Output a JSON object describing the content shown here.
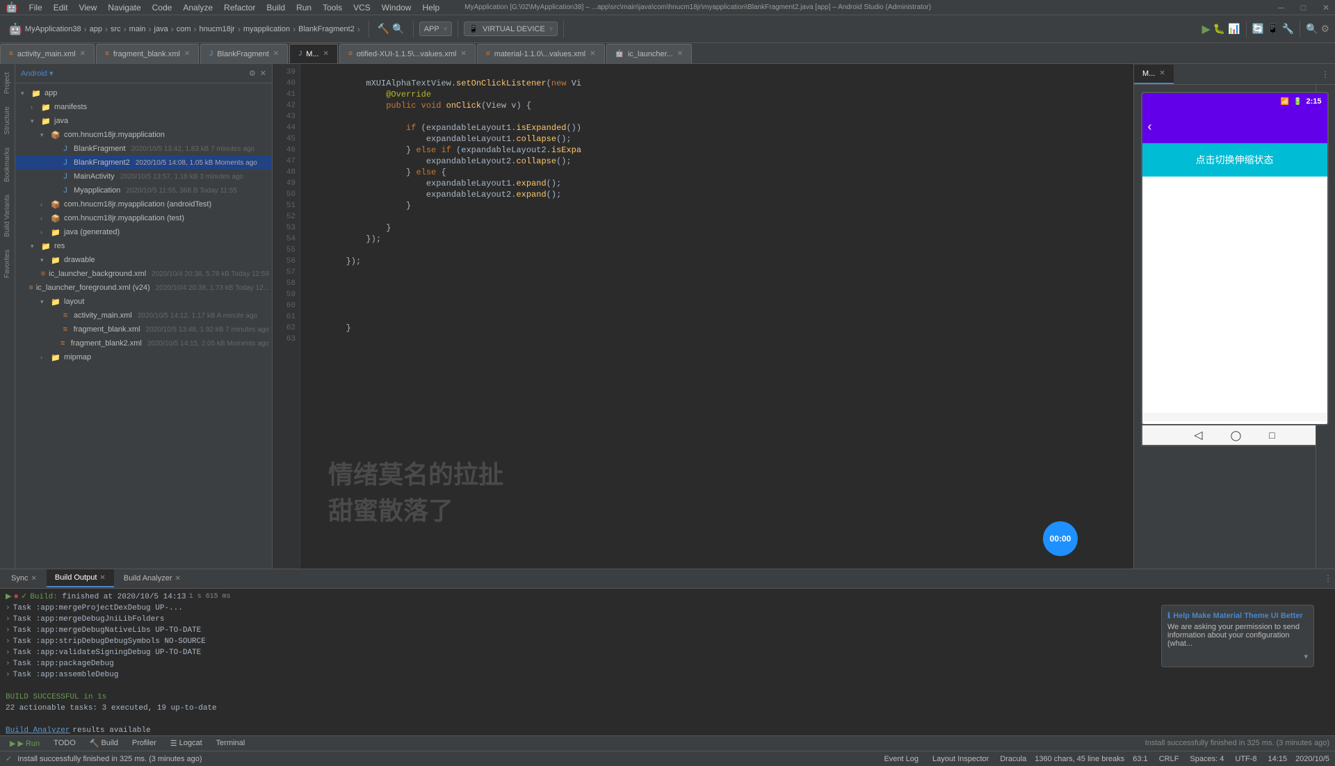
{
  "app": {
    "title": "MyApplication [G:\\02\\MyApplication38] – ...app\\src\\main\\java\\com\\hnucm18jr\\myapplication\\BlankFragment2.java [app] – Android Studio (Administrator)"
  },
  "menu": {
    "items": [
      "File",
      "Edit",
      "View",
      "Navigate",
      "Code",
      "Analyze",
      "Refactor",
      "Build",
      "Run",
      "Tools",
      "VCS",
      "Window",
      "Help"
    ]
  },
  "toolbar": {
    "project_label": "MyApplication38",
    "run_config": "APP",
    "device": "VIRTUAL DEVICE"
  },
  "breadcrumb": {
    "path": "MyApplication38 > app > src > main > java > com > hnucm18jr > myapplication > BlankFragment2"
  },
  "tabs": {
    "items": [
      {
        "label": "activity_main.xml",
        "closable": true
      },
      {
        "label": "fragment_blank.xml",
        "closable": true
      },
      {
        "label": "BlankFragment",
        "closable": true
      },
      {
        "label": "M...",
        "active": true,
        "closable": true
      },
      {
        "label": "otified-XUI-1.1.5\\...values.xml",
        "closable": true
      },
      {
        "label": "material-1.1.0\\...values.xml",
        "closable": true
      },
      {
        "label": "ic_launcher...",
        "closable": true
      }
    ]
  },
  "sidebar": {
    "header": "Android",
    "tree": [
      {
        "label": "app",
        "level": 0,
        "expanded": true,
        "type": "folder"
      },
      {
        "label": "manifests",
        "level": 1,
        "expanded": false,
        "type": "folder"
      },
      {
        "label": "java",
        "level": 1,
        "expanded": true,
        "type": "folder"
      },
      {
        "label": "com.hnucm18jr.myapplication",
        "level": 2,
        "expanded": true,
        "type": "package"
      },
      {
        "label": "BlankFragment",
        "level": 3,
        "type": "java",
        "meta": "2020/10/5 13:42, 1.83 kB 7 minutes ago"
      },
      {
        "label": "BlankFragment2",
        "level": 3,
        "type": "java",
        "active": true,
        "meta": "2020/10/5 14:08, 1.05 kB Moments ago"
      },
      {
        "label": "MainActivity",
        "level": 3,
        "type": "java",
        "meta": "2020/10/5 13:57, 1.18 kB 3 minutes ago"
      },
      {
        "label": "Myapplication",
        "level": 3,
        "type": "java",
        "meta": "2020/10/5 11:55, 368 B Today 11:55"
      },
      {
        "label": "com.hnucm18jr.myapplication (androidTest)",
        "level": 2,
        "expanded": false,
        "type": "package"
      },
      {
        "label": "com.hnucm18jr.myapplication (test)",
        "level": 2,
        "expanded": false,
        "type": "package"
      },
      {
        "label": "java (generated)",
        "level": 2,
        "expanded": false,
        "type": "folder"
      },
      {
        "label": "res",
        "level": 1,
        "expanded": true,
        "type": "folder"
      },
      {
        "label": "drawable",
        "level": 2,
        "expanded": true,
        "type": "folder"
      },
      {
        "label": "ic_launcher_background.xml",
        "level": 3,
        "type": "xml",
        "meta": "2020/10/4 20:38, 5.78 kB Today 12:59"
      },
      {
        "label": "ic_launcher_foreground.xml (v24)",
        "level": 3,
        "type": "xml",
        "meta": "2020/10/4 20:38, 1.73 kB Today 12..."
      },
      {
        "label": "layout",
        "level": 2,
        "expanded": true,
        "type": "folder"
      },
      {
        "label": "activity_main.xml",
        "level": 3,
        "type": "xml",
        "meta": "2020/10/5 14:12, 1.17 kB A minute ago"
      },
      {
        "label": "fragment_blank.xml",
        "level": 3,
        "type": "xml",
        "meta": "2020/10/5 13:48, 1.92 kB 7 minutes ago"
      },
      {
        "label": "fragment_blank2.xml",
        "level": 3,
        "type": "xml",
        "meta": "2020/10/5 14:15, 2.05 kB Moments ago"
      },
      {
        "label": "mipmap",
        "level": 2,
        "expanded": false,
        "type": "folder"
      }
    ]
  },
  "code": {
    "lines": [
      {
        "num": 39,
        "text": ""
      },
      {
        "num": 40,
        "text": "            mXUIAlphaTextView.setOnClickListener(new Vi"
      },
      {
        "num": 41,
        "text": "                @Override"
      },
      {
        "num": 42,
        "text": "                public void onClick(View v) {"
      },
      {
        "num": 43,
        "text": ""
      },
      {
        "num": 44,
        "text": "                    if (expandableLayout1.isExpanded())"
      },
      {
        "num": 45,
        "text": "                        expandableLayout1.collapse();"
      },
      {
        "num": 46,
        "text": "                    } else if (expandableLayout2.isExpa"
      },
      {
        "num": 47,
        "text": "                        expandableLayout2.collapse();"
      },
      {
        "num": 48,
        "text": "                    } else {"
      },
      {
        "num": 49,
        "text": "                        expandableLayout1.expand();"
      },
      {
        "num": 50,
        "text": "                        expandableLayout2.expand();"
      },
      {
        "num": 51,
        "text": "                    }"
      },
      {
        "num": 52,
        "text": ""
      },
      {
        "num": 53,
        "text": "                }"
      },
      {
        "num": 54,
        "text": "            });"
      },
      {
        "num": 55,
        "text": ""
      },
      {
        "num": 56,
        "text": "        });"
      },
      {
        "num": 57,
        "text": ""
      },
      {
        "num": 58,
        "text": ""
      },
      {
        "num": 59,
        "text": ""
      },
      {
        "num": 60,
        "text": ""
      },
      {
        "num": 61,
        "text": ""
      },
      {
        "num": 62,
        "text": "        }"
      },
      {
        "num": 63,
        "text": ""
      }
    ]
  },
  "device": {
    "tab_label": "M...",
    "status_time": "2:15",
    "button_text": "点击切换伸缩状态",
    "back_symbol": "‹"
  },
  "build_panel": {
    "tabs": [
      {
        "label": "Sync",
        "closable": true
      },
      {
        "label": "Build Output",
        "active": true,
        "closable": true
      },
      {
        "label": "Build Analyzer",
        "closable": true
      }
    ],
    "header": "Build: finished at 2020/10/5 14:13",
    "time": "1 s 615 ms",
    "lines": [
      {
        "text": "> Task :app:mergeProjectDexDebug UP-..."
      },
      {
        "text": "> Task :app:mergeDebugJniLibFolders"
      },
      {
        "text": "> Task :app:mergeDebugNativeLibs UP-TO-DATE"
      },
      {
        "text": "> Task :app:stripDebugDebugSymbols NO-SOURCE"
      },
      {
        "text": "> Task :app:validateSigningDebug UP-TO-DATE"
      },
      {
        "text": "> Task :app:packageDebug"
      },
      {
        "text": "> Task :app:assembleDebug"
      },
      {
        "text": ""
      },
      {
        "text": "BUILD SUCCESSFUL in 1s"
      },
      {
        "text": "22 actionable tasks: 3 executed, 19 up-to-date"
      },
      {
        "text": ""
      },
      {
        "text": "Build Analyzer results available"
      }
    ]
  },
  "run_bar": {
    "run_label": "▶ Run",
    "todo_label": "TODO",
    "build_label": "Build",
    "profiler_label": "Profiler",
    "logcat_label": "Logcat",
    "terminal_label": "Terminal",
    "status_text": "Install successfully finished in 325 ms. (3 minutes ago)"
  },
  "status_bar": {
    "theme": "Dracula",
    "chars": "1360 chars, 45 line breaks",
    "position": "63:1",
    "line_ending": "CRLF",
    "spaces": "4",
    "encoding": "UTF-8",
    "time": "14:15",
    "date": "2020/10/5",
    "event_log_label": "Event Log",
    "layout_inspector_label": "Layout Inspector"
  },
  "notification": {
    "title": "Help Make Material Theme UI Better",
    "body": "We are asking your permission to send information about your configuration (what..."
  },
  "watermark": {
    "line1": "情绪莫名的拉扯",
    "line2": "甜蜜散落了"
  },
  "timer": {
    "label": "00:00"
  },
  "right_toolbar": {
    "buttons": [
      "≡",
      "◉",
      "▶",
      "⏸",
      "⏹",
      "⏺",
      "⋯"
    ]
  }
}
